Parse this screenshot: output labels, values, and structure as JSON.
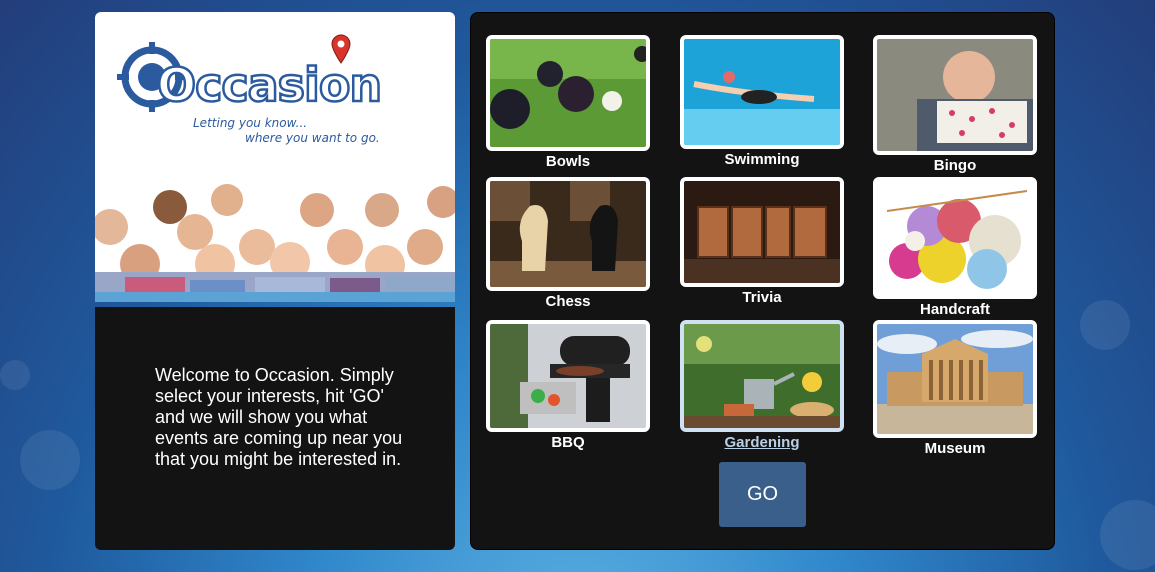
{
  "brand": {
    "name": "Occasion",
    "tagline_line1": "Letting you know...",
    "tagline_line2": "where you want to go."
  },
  "welcome_text": "Welcome to Occasion. Simply select your interests, hit 'GO' and we will show you what events are coming up near you that you might be interested in.",
  "interests": [
    {
      "label": "Bowls",
      "selected": false
    },
    {
      "label": "Swimming",
      "selected": false
    },
    {
      "label": "Bingo",
      "selected": false
    },
    {
      "label": "Chess",
      "selected": false
    },
    {
      "label": "Trivia",
      "selected": false
    },
    {
      "label": "Handcraft",
      "selected": false
    },
    {
      "label": "BBQ",
      "selected": false
    },
    {
      "label": "Gardening",
      "selected": true
    },
    {
      "label": "Museum",
      "selected": false
    }
  ],
  "go_button": "GO",
  "colors": {
    "brand_blue": "#2b5a9e",
    "panel": "#131313",
    "go_button": "#3a5f8a",
    "selected_border": "#cfe1f3"
  }
}
